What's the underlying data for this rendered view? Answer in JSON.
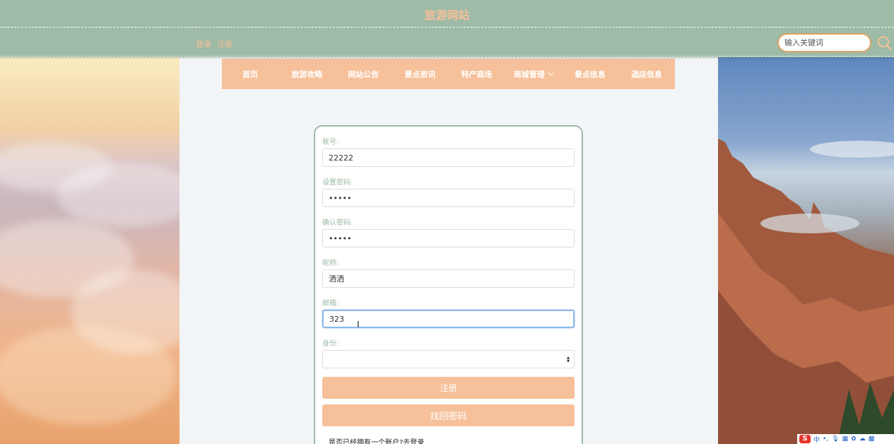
{
  "header": {
    "site_title": "旅游网站",
    "login_link": "登录",
    "register_link": "注册",
    "search_placeholder": "输入关键词"
  },
  "nav": {
    "items": [
      {
        "label": "首页"
      },
      {
        "label": "旅游攻略"
      },
      {
        "label": "网站公告"
      },
      {
        "label": "景点资讯"
      },
      {
        "label": "特产商场"
      },
      {
        "label": "商城管理",
        "has_dropdown": true
      },
      {
        "label": "景点信息"
      },
      {
        "label": "酒店信息"
      }
    ]
  },
  "form": {
    "account_label": "账号:",
    "account_value": "22222",
    "password_label": "设置密码:",
    "password_value": "•••••",
    "confirm_label": "确认密码:",
    "confirm_value": "•••••",
    "nickname_label": "昵称:",
    "nickname_value": "洒洒",
    "email_label": "邮箱:",
    "email_value": "323",
    "identity_label": "身份:",
    "identity_value": "",
    "register_button": "注册",
    "recover_button": "找回密码",
    "login_prompt": "是否已经拥有一个账户?去登录"
  },
  "tray": {
    "ime_logo": "S",
    "ime_mode": "中"
  },
  "colors": {
    "header_bg": "#9dbba6",
    "accent": "#f6c09a",
    "page_bg": "#f2f5f7"
  }
}
